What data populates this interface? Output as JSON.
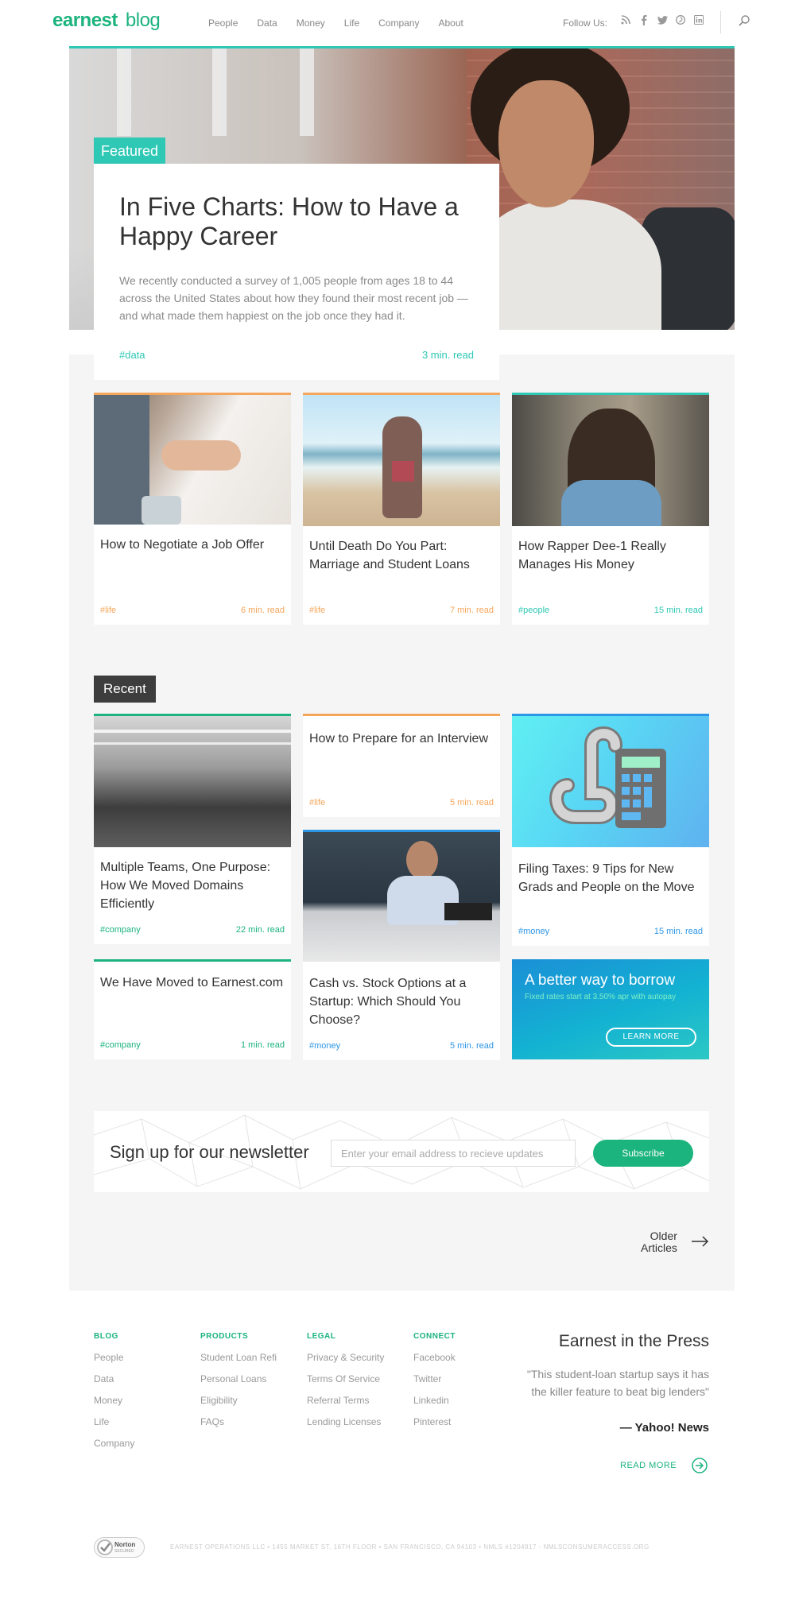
{
  "brand": {
    "name": "earnest",
    "suffix": "blog",
    "accent": "#1bb37e",
    "teal": "#2ec8b4",
    "orange": "#f5a65b",
    "blue": "#2d96e6"
  },
  "nav": [
    "People",
    "Data",
    "Money",
    "Life",
    "Company",
    "About"
  ],
  "follow_label": "Follow Us:",
  "socials": [
    "rss-icon",
    "facebook-icon",
    "twitter-icon",
    "pinterest-icon",
    "linkedin-icon"
  ],
  "featured": {
    "badge": "Featured",
    "title": "In Five Charts: How to Have a Happy Career",
    "description": "We recently conducted a survey of 1,005 people from ages 18 to 44 across the United States about how they found their most recent job — and what made them happiest on the job once they had it.",
    "tag": "#data",
    "read_time": "3 min. read"
  },
  "top_posts": [
    {
      "title": "How to Negotiate a Job Offer",
      "tag": "#life",
      "read_time": "6 min. read"
    },
    {
      "title": "Until Death Do You Part: Marriage and Student Loans",
      "tag": "#life",
      "read_time": "7 min. read"
    },
    {
      "title": "How Rapper Dee-1 Really Manages His Money",
      "tag": "#people",
      "read_time": "15 min. read"
    }
  ],
  "recent_label": "Recent",
  "recent_posts": [
    {
      "title": "Multiple Teams, One Purpose: How We Moved Domains Efficiently",
      "tag": "#company",
      "read_time": "22 min. read"
    },
    {
      "title": "How to Prepare for an Interview",
      "tag": "#life",
      "read_time": "5 min. read"
    },
    {
      "title": "Filing Taxes: 9 Tips for New Grads and People on the Move",
      "tag": "#money",
      "read_time": "15 min. read"
    },
    {
      "title": "We Have Moved to Earnest.com",
      "tag": "#company",
      "read_time": "1 min. read"
    },
    {
      "title": "Cash vs. Stock Options at a Startup: Which Should You Choose?",
      "tag": "#money",
      "read_time": "5 min. read"
    }
  ],
  "promo": {
    "title": "A better way to borrow",
    "subtitle": "Fixed rates start at 3.50% apr with autopay",
    "button": "LEARN MORE"
  },
  "newsletter": {
    "title": "Sign up for our newsletter",
    "placeholder": "Enter your email address to recieve updates",
    "button": "Subscribe"
  },
  "older": {
    "line1": "Older",
    "line2": "Articles"
  },
  "footer": {
    "columns": [
      {
        "heading": "BLOG",
        "links": [
          "People",
          "Data",
          "Money",
          "Life",
          "Company"
        ]
      },
      {
        "heading": "PRODUCTS",
        "links": [
          "Student Loan Refi",
          "Personal Loans",
          "Eligibility",
          "FAQs"
        ]
      },
      {
        "heading": "LEGAL",
        "links": [
          "Privacy & Security",
          "Terms Of Service",
          "Referral Terms",
          "Lending Licenses"
        ]
      },
      {
        "heading": "CONNECT",
        "links": [
          "Facebook",
          "Twitter",
          "Linkedin",
          "Pinterest"
        ]
      }
    ],
    "press_title": "Earnest in the Press",
    "press_quote": "\"This student-loan startup says it has the killer feature to beat big lenders\"",
    "press_source": "— Yahoo! News",
    "read_more": "READ MORE",
    "norton": "Norton",
    "norton_sub": "SECURED",
    "legal": "EARNEST OPERATIONS LLC  •  1455 MARKET ST, 16TH FLOOR  •  SAN FRANCISCO, CA 94103  •  NMLS #1204917 - NMLSCONSUMERACCESS.ORG"
  }
}
